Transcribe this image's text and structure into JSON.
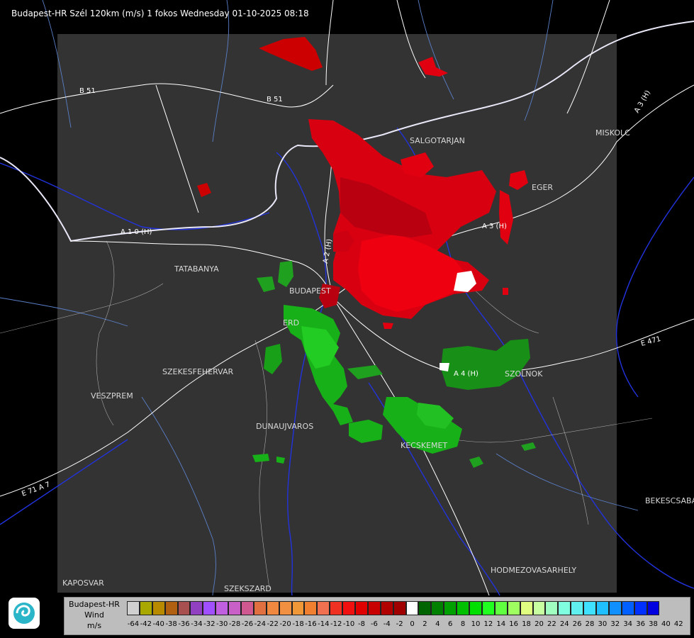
{
  "title": "Budapest-HR Szél 120km (m/s) 1 fokos Wednesday 01-10-2025 08:18",
  "cities": [
    "SALGOTARJAN",
    "MISKOLC",
    "EGER",
    "TATABANYA",
    "BUDAPEST",
    "ERD",
    "SZEKESFEHERVAR",
    "VESZPREM",
    "DUNAUJVAROS",
    "KECSKEMET",
    "SZOLNOK",
    "BEKESCSABA",
    "HODMEZOVASARHELY",
    "KAPOSVAR",
    "SZEKSZARD"
  ],
  "roads": [
    "B 51",
    "B 51",
    "A 1 0 (H)",
    "A 3 (H)",
    "A 3 (H)",
    "A 2 (H)",
    "A 4 (H)",
    "E 471",
    "E 71 A 7"
  ],
  "legend": {
    "line1": "Budapest-HR",
    "line2": "Wind",
    "line3": "m/s",
    "ticks": [
      "-64",
      "-42",
      "-40",
      "-38",
      "-36",
      "-34",
      "-32",
      "-30",
      "-28",
      "-26",
      "-24",
      "-22",
      "-20",
      "-18",
      "-16",
      "-14",
      "-12",
      "-10",
      "-8",
      "-6",
      "-4",
      "-2",
      "0",
      "2",
      "4",
      "6",
      "8",
      "10",
      "12",
      "14",
      "16",
      "18",
      "20",
      "22",
      "24",
      "26",
      "28",
      "30",
      "32",
      "34",
      "36",
      "38",
      "40",
      "42"
    ],
    "colors": [
      "#d0d0d0",
      "#a8a800",
      "#b88a00",
      "#b06010",
      "#a85050",
      "#9040c0",
      "#a050ff",
      "#c060e0",
      "#c860c8",
      "#d05890",
      "#e07040",
      "#f08840",
      "#f09040",
      "#f09838",
      "#f08030",
      "#f07050",
      "#f03020",
      "#f01010",
      "#e00000",
      "#c80000",
      "#b00000",
      "#a00000",
      "#ffffff",
      "#006400",
      "#008000",
      "#00a000",
      "#00c000",
      "#00e000",
      "#20ff20",
      "#60ff40",
      "#a0ff60",
      "#e0ff80",
      "#c8ffa0",
      "#a0ffc0",
      "#80ffe0",
      "#60f0f0",
      "#40e0ff",
      "#20c0ff",
      "#1090ff",
      "#0060ff",
      "#0030ff",
      "#0000e0"
    ]
  }
}
